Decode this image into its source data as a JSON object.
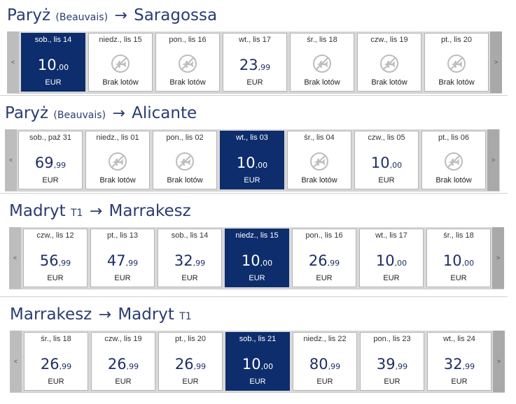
{
  "nav": {
    "prev": "<",
    "next": ">"
  },
  "routes": [
    {
      "from": "Paryż",
      "from_airport": "(Beauvais)",
      "arrow": "→",
      "to": "Saragossa",
      "to_airport": "",
      "days": [
        {
          "label": "sob., lis 14",
          "price": "10",
          "cents": ",00",
          "currency": "EUR",
          "status": "",
          "selected": true
        },
        {
          "label": "niedz., lis 15",
          "price": "",
          "cents": "",
          "currency": "",
          "status": "Brak lotów",
          "selected": false
        },
        {
          "label": "pon., lis 16",
          "price": "",
          "cents": "",
          "currency": "",
          "status": "Brak lotów",
          "selected": false
        },
        {
          "label": "wt., lis 17",
          "price": "23",
          "cents": ",99",
          "currency": "EUR",
          "status": "",
          "selected": false
        },
        {
          "label": "śr., lis 18",
          "price": "",
          "cents": "",
          "currency": "",
          "status": "Brak lotów",
          "selected": false
        },
        {
          "label": "czw., lis 19",
          "price": "",
          "cents": "",
          "currency": "",
          "status": "Brak lotów",
          "selected": false
        },
        {
          "label": "pt., lis 20",
          "price": "",
          "cents": "",
          "currency": "",
          "status": "Brak lotów",
          "selected": false
        }
      ]
    },
    {
      "from": "Paryż",
      "from_airport": "(Beauvais)",
      "arrow": "→",
      "to": "Alicante",
      "to_airport": "",
      "days": [
        {
          "label": "sob., paź 31",
          "price": "69",
          "cents": ",99",
          "currency": "EUR",
          "status": "",
          "selected": false
        },
        {
          "label": "niedz., lis 01",
          "price": "",
          "cents": "",
          "currency": "",
          "status": "Brak lotów",
          "selected": false
        },
        {
          "label": "pon., lis 02",
          "price": "",
          "cents": "",
          "currency": "",
          "status": "Brak lotów",
          "selected": false
        },
        {
          "label": "wt., lis 03",
          "price": "10",
          "cents": ",00",
          "currency": "EUR",
          "status": "",
          "selected": true
        },
        {
          "label": "śr., lis 04",
          "price": "",
          "cents": "",
          "currency": "",
          "status": "Brak lotów",
          "selected": false
        },
        {
          "label": "czw., lis 05",
          "price": "10",
          "cents": ",00",
          "currency": "EUR",
          "status": "",
          "selected": false
        },
        {
          "label": "pt., lis 06",
          "price": "",
          "cents": "",
          "currency": "",
          "status": "Brak lotów",
          "selected": false
        }
      ]
    },
    {
      "from": "Madryt",
      "from_airport": "T1",
      "arrow": "→",
      "to": "Marrakesz",
      "to_airport": "",
      "days": [
        {
          "label": "czw., lis 12",
          "price": "56",
          "cents": ",99",
          "currency": "EUR",
          "status": "",
          "selected": false
        },
        {
          "label": "pt., lis 13",
          "price": "47",
          "cents": ",99",
          "currency": "EUR",
          "status": "",
          "selected": false
        },
        {
          "label": "sob., lis 14",
          "price": "32",
          "cents": ",99",
          "currency": "EUR",
          "status": "",
          "selected": false
        },
        {
          "label": "niedz., lis 15",
          "price": "10",
          "cents": ",00",
          "currency": "EUR",
          "status": "",
          "selected": true
        },
        {
          "label": "pon., lis 16",
          "price": "26",
          "cents": ",99",
          "currency": "EUR",
          "status": "",
          "selected": false
        },
        {
          "label": "wt., lis 17",
          "price": "10",
          "cents": ",00",
          "currency": "EUR",
          "status": "",
          "selected": false
        },
        {
          "label": "śr., lis 18",
          "price": "10",
          "cents": ",00",
          "currency": "EUR",
          "status": "",
          "selected": false
        }
      ]
    },
    {
      "from": "Marrakesz",
      "from_airport": "",
      "arrow": "→",
      "to": "Madryt",
      "to_airport": "T1",
      "days": [
        {
          "label": "śr., lis 18",
          "price": "26",
          "cents": ",99",
          "currency": "EUR",
          "status": "",
          "selected": false
        },
        {
          "label": "czw., lis 19",
          "price": "26",
          "cents": ",99",
          "currency": "EUR",
          "status": "",
          "selected": false
        },
        {
          "label": "pt., lis 20",
          "price": "26",
          "cents": ",99",
          "currency": "EUR",
          "status": "",
          "selected": false
        },
        {
          "label": "sob., lis 21",
          "price": "10",
          "cents": ",00",
          "currency": "EUR",
          "status": "",
          "selected": true
        },
        {
          "label": "niedz., lis 22",
          "price": "80",
          "cents": ",99",
          "currency": "EUR",
          "status": "",
          "selected": false
        },
        {
          "label": "pon., lis 23",
          "price": "39",
          "cents": ",99",
          "currency": "EUR",
          "status": "",
          "selected": false
        },
        {
          "label": "wt., lis 24",
          "price": "32",
          "cents": ",99",
          "currency": "EUR",
          "status": "",
          "selected": false
        }
      ]
    }
  ]
}
